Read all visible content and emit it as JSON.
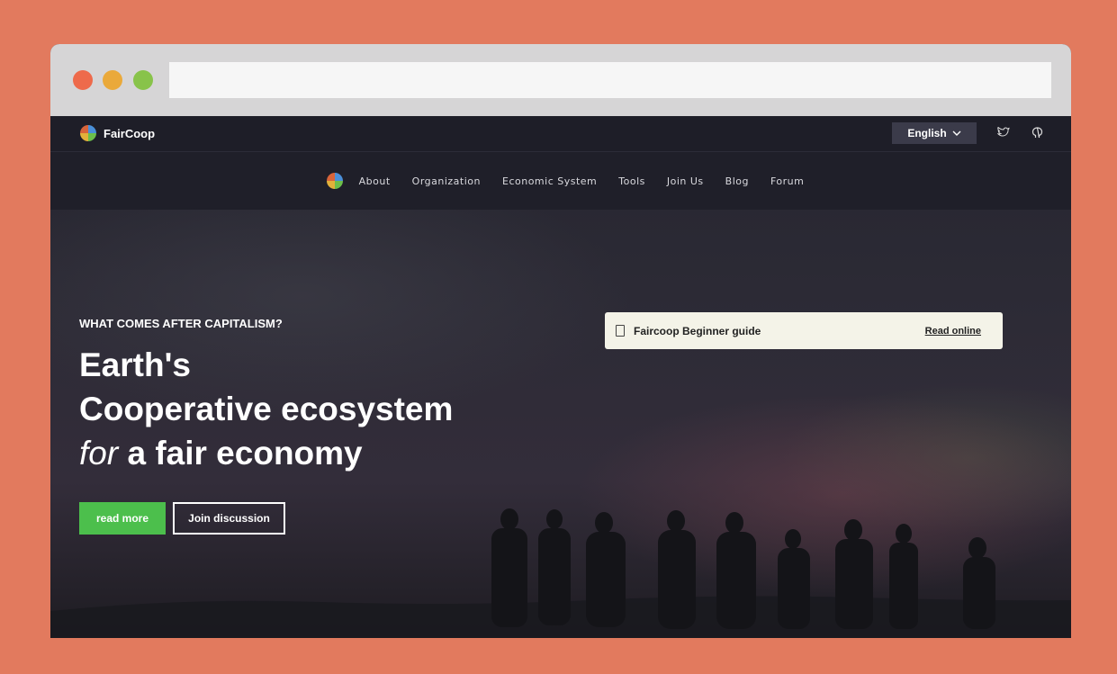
{
  "brand": {
    "name": "FairCoop"
  },
  "topbar": {
    "language": "English",
    "icons": [
      "twitter-icon",
      "github-icon"
    ]
  },
  "nav": {
    "items": [
      {
        "label": "About"
      },
      {
        "label": "Organization"
      },
      {
        "label": "Economic System"
      },
      {
        "label": "Tools"
      },
      {
        "label": "Join Us"
      },
      {
        "label": "Blog"
      },
      {
        "label": "Forum"
      }
    ]
  },
  "hero": {
    "kicker": "WHAT COMES AFTER CAPITALISM?",
    "title_line1": "Earth's",
    "title_line2": "Cooperative ecosystem",
    "title_line3_em": "for",
    "title_line3_rest": " a fair economy",
    "primary_button": "read more",
    "secondary_button": "Join discussion"
  },
  "guide": {
    "title": "Faircoop Beginner guide",
    "link": "Read online"
  },
  "colors": {
    "background": "#e27a5e",
    "accent_green": "#4cbf4c",
    "guide_bg": "#f4f3e8",
    "dark": "#1f1f29"
  }
}
